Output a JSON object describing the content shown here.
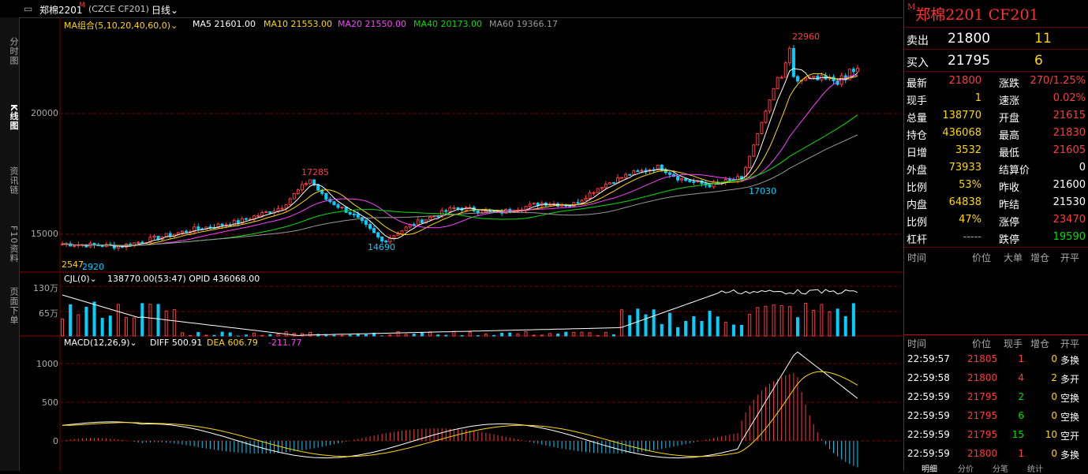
{
  "header": {
    "symbol_label": "郑棉2201",
    "superscript": "M",
    "exchange_code": "(CZCE CF201)",
    "period": "日线"
  },
  "left_tabs": [
    "分时图",
    "K线图",
    "资讯链",
    "F10资料",
    "页面下单"
  ],
  "main_chart": {
    "ma_group_label": "MA组合(5,10,20,40,60,0)",
    "ma5": "MA5 21601.00",
    "ma10": "MA10 21553.00",
    "ma20": "MA20 21550.00",
    "ma40": "MA40 20173.00",
    "ma60": "MA60 19366.17",
    "y_labels": [
      "20000",
      "15000"
    ],
    "peak_high_label": "22960",
    "local_high_label": "17285",
    "local_low_label": "14690",
    "recent_low_label": "17030",
    "bottom_left_a": "2547",
    "bottom_left_b": "2920"
  },
  "volume_chart": {
    "label": "CJL(0)",
    "value": "138770.00(53:47)  OPID 436068.00",
    "y_labels": [
      "130万",
      "65万"
    ]
  },
  "macd_chart": {
    "label": "MACD(12,26,9)",
    "diff": "DIFF 500.91",
    "dea": "DEA 606.79",
    "macd": "-211.77",
    "y_labels": [
      "1000",
      "500",
      "0"
    ]
  },
  "colors": {
    "up": "#ff3b3b",
    "down": "#00d0ff",
    "ma5": "#ffffff",
    "ma10": "#ffd700",
    "ma20": "#ff40ff",
    "ma40": "#00e000",
    "ma60": "#999999"
  },
  "right_panel": {
    "title": "郑棉2201  CF201",
    "superscript": "M",
    "ask_label": "卖出",
    "ask_price": "21800",
    "ask_qty": "11",
    "bid_label": "买入",
    "bid_price": "21795",
    "bid_qty": "6",
    "stats": [
      {
        "l1": "最新",
        "v1": "21800",
        "c1": "red",
        "l2": "涨跌",
        "v2": "270/1.25%",
        "c2": "red"
      },
      {
        "l1": "现手",
        "v1": "1",
        "c1": "yellow",
        "l2": "速涨",
        "v2": "0.02%",
        "c2": "red"
      },
      {
        "l1": "总量",
        "v1": "138770",
        "c1": "yellow",
        "l2": "开盘",
        "v2": "21615",
        "c2": "red"
      },
      {
        "l1": "持仓",
        "v1": "436068",
        "c1": "yellow",
        "l2": "最高",
        "v2": "21830",
        "c2": "red"
      },
      {
        "l1": "日增",
        "v1": "3532",
        "c1": "yellow",
        "l2": "最低",
        "v2": "21605",
        "c2": "red"
      },
      {
        "l1": "外盘",
        "v1": "73933",
        "c1": "yellow",
        "l2": "结算价",
        "v2": "0",
        "c2": "white"
      },
      {
        "l1": "比例",
        "v1": "53%",
        "c1": "yellow",
        "l2": "昨收",
        "v2": "21600",
        "c2": "white"
      },
      {
        "l1": "内盘",
        "v1": "64838",
        "c1": "yellow",
        "l2": "昨结",
        "v2": "21530",
        "c2": "white"
      },
      {
        "l1": "比例",
        "v1": "47%",
        "c1": "yellow",
        "l2": "涨停",
        "v2": "23470",
        "c2": "red"
      },
      {
        "l1": "杠杆",
        "v1": "-----",
        "c1": "gray",
        "l2": "跌停",
        "v2": "19590",
        "c2": "green"
      }
    ],
    "big_order_headers": [
      "时间",
      "价位",
      "大单",
      "增仓",
      "开平"
    ],
    "tick_headers": [
      "时间",
      "价位",
      "现手",
      "增仓",
      "开平"
    ],
    "ticks": [
      {
        "time": "22:59:57",
        "price": "21805",
        "vol": "1",
        "vc": "red",
        "oi": "0",
        "type": "多换",
        "tc": "white"
      },
      {
        "time": "22:59:58",
        "price": "21800",
        "vol": "4",
        "vc": "red",
        "oi": "2",
        "type": "多开",
        "tc": "white"
      },
      {
        "time": "22:59:59",
        "price": "21795",
        "vol": "2",
        "vc": "green",
        "oi": "0",
        "type": "空换",
        "tc": "white"
      },
      {
        "time": "22:59:59",
        "price": "21795",
        "vol": "6",
        "vc": "green",
        "oi": "0",
        "type": "空换",
        "tc": "white"
      },
      {
        "time": "22:59:59",
        "price": "21795",
        "vol": "15",
        "vc": "green",
        "oi": "10",
        "type": "空开",
        "tc": "white"
      },
      {
        "time": "22:59:59",
        "price": "21800",
        "vol": "1",
        "vc": "red",
        "oi": "0",
        "type": "多换",
        "tc": "white"
      }
    ],
    "bottom_tabs": [
      "明细",
      "分价",
      "分笔",
      "统计"
    ]
  }
}
